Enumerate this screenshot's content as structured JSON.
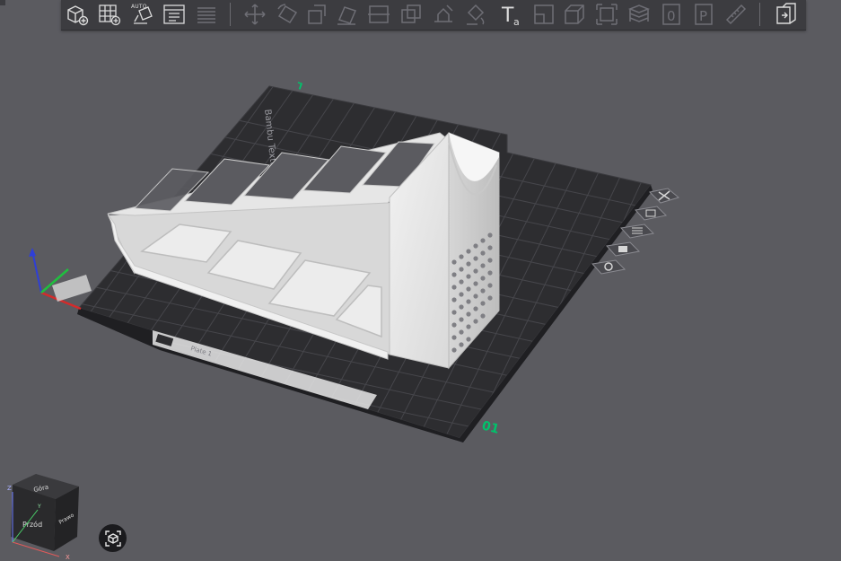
{
  "toolbar": {
    "tools": [
      {
        "icon": "add-object-icon",
        "enabled": true
      },
      {
        "icon": "add-plate-icon",
        "enabled": true
      },
      {
        "icon": "auto-orient-icon",
        "enabled": true
      },
      {
        "icon": "arrange-icon",
        "enabled": true
      },
      {
        "icon": "layers-icon",
        "enabled": false
      },
      {
        "icon": "move-icon",
        "enabled": false
      },
      {
        "icon": "rotate-icon",
        "enabled": false
      },
      {
        "icon": "scale-icon",
        "enabled": false
      },
      {
        "icon": "lay-on-face-icon",
        "enabled": false
      },
      {
        "icon": "cut-icon",
        "enabled": false
      },
      {
        "icon": "mesh-boolean-icon",
        "enabled": false
      },
      {
        "icon": "support-paint-icon",
        "enabled": false
      },
      {
        "icon": "color-paint-icon",
        "enabled": false
      },
      {
        "icon": "text-tool-icon",
        "enabled": true
      },
      {
        "icon": "variable-layer-icon",
        "enabled": false
      },
      {
        "icon": "shell-icon",
        "enabled": false
      },
      {
        "icon": "assembly-icon",
        "enabled": false
      },
      {
        "icon": "slice-stack-icon",
        "enabled": false
      },
      {
        "icon": "zero-icon",
        "enabled": false
      },
      {
        "icon": "plate-p-icon",
        "enabled": false
      },
      {
        "icon": "measure-icon",
        "enabled": false
      },
      {
        "icon": "return-icon",
        "enabled": true
      }
    ],
    "auto_label": "AUTO",
    "text_tool_glyph": "T",
    "text_tool_sub": "a",
    "zero_glyph": "0",
    "p_glyph": "P"
  },
  "plate": {
    "brand_text": "Bambu Textured PEI Plate",
    "label_tag": "Plate 1",
    "corner_mark": "01",
    "top_mark": "L"
  },
  "plate_side_buttons": [
    {
      "icon": "close-icon"
    },
    {
      "icon": "auto-orient-plate-icon"
    },
    {
      "icon": "arrange-plate-icon"
    },
    {
      "icon": "lock-icon"
    },
    {
      "icon": "settings-icon"
    }
  ],
  "nav_cube": {
    "top": "Góra",
    "front": "Przód",
    "right": "Prawo",
    "axis_z": "Z",
    "axis_x": "X",
    "axis_y": "Y"
  },
  "colors": {
    "background": "#5b5b60",
    "toolbar": "#3c3c40",
    "plate": "#2e2e31",
    "grid": "#4a4a4e",
    "model": "#e4e4e4",
    "accent_green": "#00c36b"
  }
}
